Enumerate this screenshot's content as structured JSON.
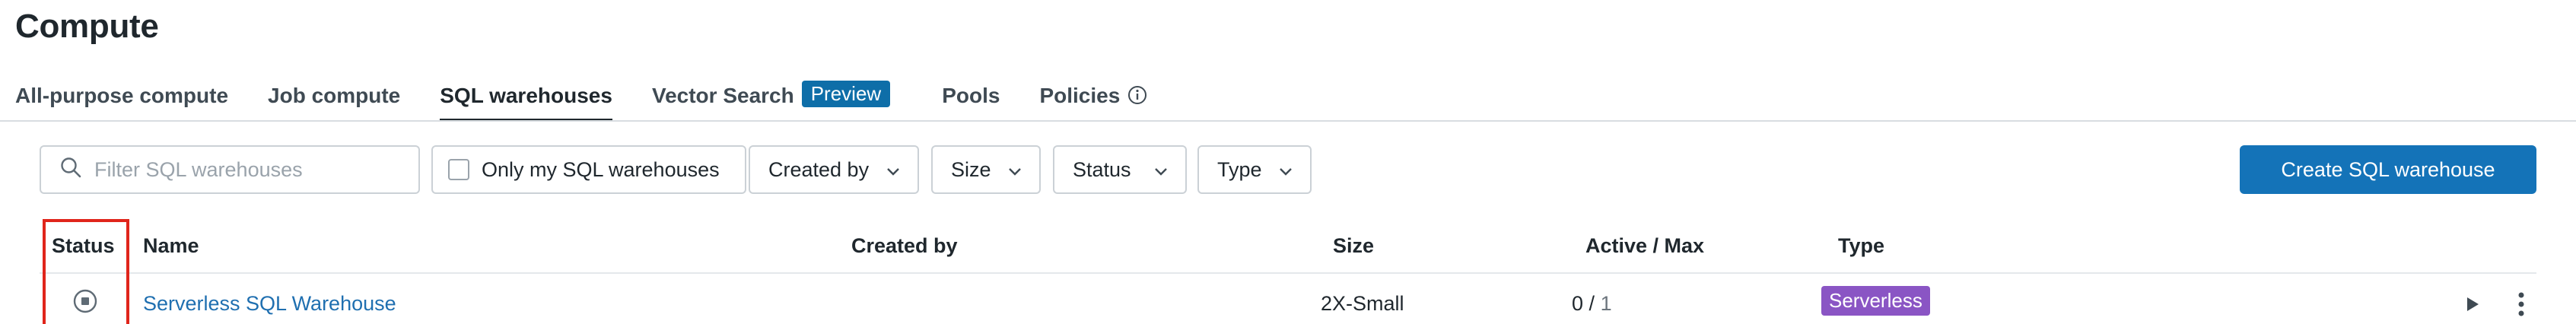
{
  "page": {
    "title": "Compute"
  },
  "tabs": [
    {
      "label": "All-purpose compute"
    },
    {
      "label": "Job compute"
    },
    {
      "label": "SQL warehouses",
      "active": true
    },
    {
      "label": "Vector Search",
      "badge": "Preview"
    },
    {
      "label": "Pools"
    },
    {
      "label": "Policies"
    }
  ],
  "toolbar": {
    "search_placeholder": "Filter SQL warehouses",
    "only_mine_label": "Only my SQL warehouses",
    "filters": [
      "Created by",
      "Size",
      "Status",
      "Type"
    ],
    "create_button": "Create SQL warehouse"
  },
  "table": {
    "columns": [
      "Status",
      "Name",
      "Created by",
      "Size",
      "Active / Max",
      "Type"
    ],
    "rows": [
      {
        "status_icon": "stopped-icon",
        "name": "Serverless SQL Warehouse",
        "created_by": "",
        "size": "2X-Small",
        "active": "0",
        "sep": "/",
        "max": "1",
        "type": "Serverless"
      }
    ]
  },
  "colors": {
    "accent": "#1473b8",
    "link": "#1f6fb0",
    "preview_badge": "#0e6ea8",
    "serverless_badge": "#8a55c4",
    "highlight": "#e0251b"
  }
}
